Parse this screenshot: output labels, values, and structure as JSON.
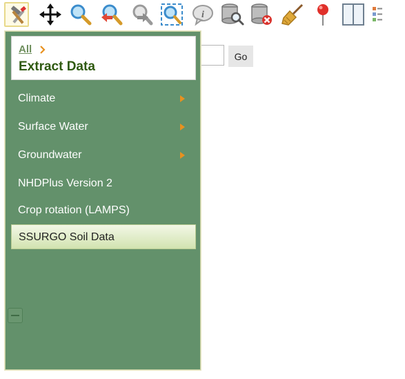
{
  "search": {
    "value": "",
    "placeholder": "",
    "go_label": "Go"
  },
  "panel": {
    "breadcrumb_all": "All",
    "title": "Extract Data",
    "items": [
      {
        "label": "Climate",
        "has_submenu": true
      },
      {
        "label": "Surface Water",
        "has_submenu": true
      },
      {
        "label": "Groundwater",
        "has_submenu": true
      },
      {
        "label": "NHDPlus Version 2",
        "has_submenu": false
      },
      {
        "label": "Crop rotation (LAMPS)",
        "has_submenu": false
      },
      {
        "label": "SSURGO Soil Data",
        "has_submenu": false,
        "selected": true
      }
    ]
  },
  "toolbar": {
    "tools": [
      {
        "icon": "hammer-wrench-icon",
        "active": true
      },
      {
        "icon": "move-pan-icon"
      },
      {
        "icon": "zoom-in-icon"
      },
      {
        "icon": "zoom-previous-icon"
      },
      {
        "icon": "zoom-next-icon"
      },
      {
        "icon": "zoom-extent-icon"
      },
      {
        "icon": "info-bubble-icon"
      },
      {
        "icon": "database-search-icon"
      },
      {
        "icon": "database-delete-icon"
      },
      {
        "icon": "broom-clear-icon"
      },
      {
        "icon": "map-pin-icon"
      },
      {
        "icon": "panel-layout-icon"
      },
      {
        "icon": "legend-list-icon"
      }
    ]
  },
  "colors": {
    "panel_bg": "#63916b",
    "title_green": "#2f5a10",
    "arrow_orange": "#e8911f"
  }
}
